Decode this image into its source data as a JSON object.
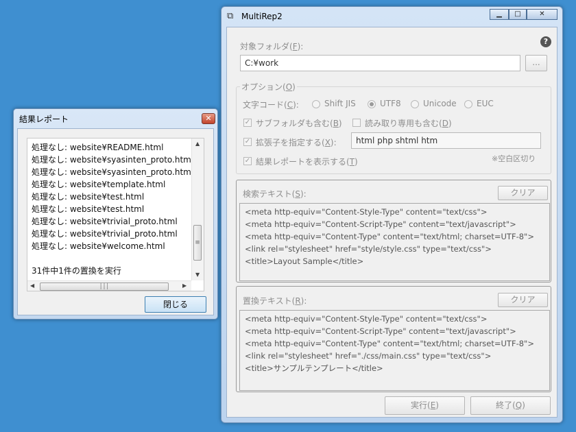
{
  "main_window": {
    "title": "MultiRep2",
    "help_icon": "?",
    "target_folder": {
      "label": "対象フォルダ(",
      "key": "F",
      "suffix": "):",
      "value": "C:¥work",
      "browse_label": "..."
    },
    "options": {
      "group_label": "オプション(",
      "group_key": "O",
      "group_suffix": ")",
      "charcode_label": "文字コード(",
      "charcode_key": "C",
      "charcode_suffix": "):",
      "charcodes": [
        "Shift JIS",
        "UTF8",
        "Unicode",
        "EUC"
      ],
      "selected_charcode": "UTF8",
      "subfolder": {
        "label": "サブフォルダも含む(",
        "key": "B",
        "suffix": ")",
        "checked": true
      },
      "readonly": {
        "label": "読み取り専用も含む(",
        "key": "D",
        "suffix": ")",
        "checked": false
      },
      "extension": {
        "label": "拡張子を指定する(",
        "key": "X",
        "suffix": "):",
        "checked": true,
        "value": "html php shtml htm"
      },
      "show_report": {
        "label": "結果レポートを表示する(",
        "key": "T",
        "suffix": ")",
        "checked": true
      },
      "space_note": "※空白区切り"
    },
    "search": {
      "label": "検索テキスト(",
      "key": "S",
      "suffix": "):",
      "clear_label": "クリア",
      "text": "<meta http-equiv=\"Content-Style-Type\" content=\"text/css\">\n<meta http-equiv=\"Content-Script-Type\" content=\"text/javascript\">\n<meta http-equiv=\"Content-Type\" content=\"text/html; charset=UTF-8\">\n<link rel=\"stylesheet\" href=\"style/style.css\" type=\"text/css\">\n<title>Layout Sample</title>"
    },
    "replace": {
      "label": "置換テキスト(",
      "key": "R",
      "suffix": "):",
      "clear_label": "クリア",
      "text": "<meta http-equiv=\"Content-Style-Type\" content=\"text/css\">\n<meta http-equiv=\"Content-Script-Type\" content=\"text/javascript\">\n<meta http-equiv=\"Content-Type\" content=\"text/html; charset=UTF-8\">\n<link rel=\"stylesheet\" href=\"./css/main.css\" type=\"text/css\">\n<title>サンプルテンプレート</title>"
    },
    "execute": {
      "label": "実行(",
      "key": "E",
      "suffix": ")"
    },
    "quit": {
      "label": "終了(",
      "key": "Q",
      "suffix": ")"
    }
  },
  "report_window": {
    "title": "結果レポート",
    "lines": [
      "処理なし: website¥README.html",
      "処理なし: website¥syasinten_proto.htm",
      "処理なし: website¥syasinten_proto.htm",
      "処理なし: website¥template.html",
      "処理なし: website¥test.html",
      "処理なし: website¥test.html",
      "処理なし: website¥trivial_proto.html",
      "処理なし: website¥trivial_proto.html",
      "処理なし: website¥welcome.html",
      "",
      "31件中1件の置換を実行"
    ],
    "close_label": "閉じる"
  },
  "colors": {
    "desktop": "#3f8fd0",
    "disabled_text": "#8d8d8d",
    "close_red": "#c2442c"
  }
}
